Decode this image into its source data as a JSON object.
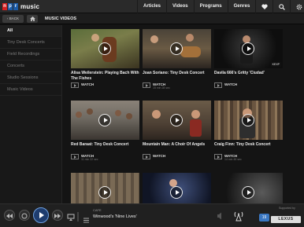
{
  "header": {
    "logo_letters": [
      "n",
      "p",
      "r"
    ],
    "logo_word": "music",
    "nav": [
      "Articles",
      "Videos",
      "Programs",
      "Genres"
    ],
    "icons": [
      "heart-icon",
      "search-icon",
      "gear-icon"
    ]
  },
  "subbar": {
    "back_label": "BACK",
    "section_title": "MUSIC VIDEOS"
  },
  "sidebar": {
    "items": [
      {
        "label": "All",
        "active": true
      },
      {
        "label": "Tiny Desk Concerts",
        "active": false
      },
      {
        "label": "Field Recordings",
        "active": false
      },
      {
        "label": "Concerts",
        "active": false
      },
      {
        "label": "Studio Sessions",
        "active": false
      },
      {
        "label": "Music Videos",
        "active": false
      }
    ]
  },
  "videos": [
    {
      "title": "Alisa Weilerstein: Playing Bach With The Fishes",
      "watch": "WATCH",
      "duration": "",
      "kexp": false
    },
    {
      "title": "Joan Soriano: Tiny Desk Concert",
      "watch": "WATCH",
      "duration": "15 min 28 sec",
      "kexp": false
    },
    {
      "title": "Davila 666's Gritty 'Ciudad'",
      "watch": "WATCH",
      "duration": "",
      "kexp": true
    },
    {
      "title": "Red Baraat: Tiny Desk Concert",
      "watch": "WATCH",
      "duration": "11 min 22 sec",
      "kexp": false
    },
    {
      "title": "Mountain Man: A Choir Of Angels",
      "watch": "WATCH",
      "duration": "",
      "kexp": false
    },
    {
      "title": "Craig Finn: Tiny Desk Concert",
      "watch": "WATCH",
      "duration": "14 min 45 sec",
      "kexp": false
    },
    {
      "title": "",
      "watch": "",
      "duration": "",
      "kexp": false
    },
    {
      "title": "",
      "watch": "",
      "duration": "",
      "kexp": false
    },
    {
      "title": "",
      "watch": "",
      "duration": "",
      "kexp": true
    }
  ],
  "player": {
    "program_label": "CAFE",
    "track_title": "Winwood's 'Nine Lives'",
    "queue_count": "19",
    "sponsor_label": "Supported by",
    "sponsor": "LEXUS"
  },
  "colors": {
    "background": "#141414",
    "npr_red": "#d62021",
    "npr_blue": "#1b5aa6",
    "play_accent": "#6ea0e0"
  }
}
